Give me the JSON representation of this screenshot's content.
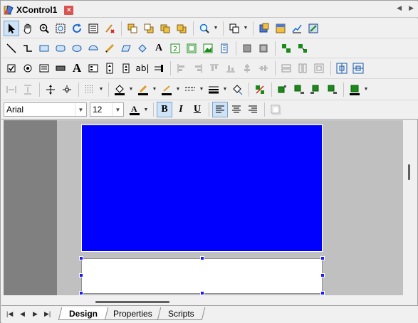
{
  "window": {
    "title": "XControl1",
    "close_icon": "close-icon",
    "nav_left_icon": "chevron-left-icon",
    "nav_right_icon": "chevron-right-icon"
  },
  "format_bar": {
    "font_family": "Arial",
    "font_size": "12",
    "font_color": "#000000",
    "bold_label": "B",
    "italic_label": "I",
    "underline_label": "U"
  },
  "canvas": {
    "panel_color": "#0000ff"
  },
  "tabs": [
    {
      "label": "Design",
      "active": true
    },
    {
      "label": "Properties",
      "active": false
    },
    {
      "label": "Scripts",
      "active": false
    }
  ],
  "toolbar_row3": {
    "text_glyph": "A",
    "edit_glyph": "ab|"
  },
  "toolbar_row2": {
    "text_glyph": "A"
  }
}
